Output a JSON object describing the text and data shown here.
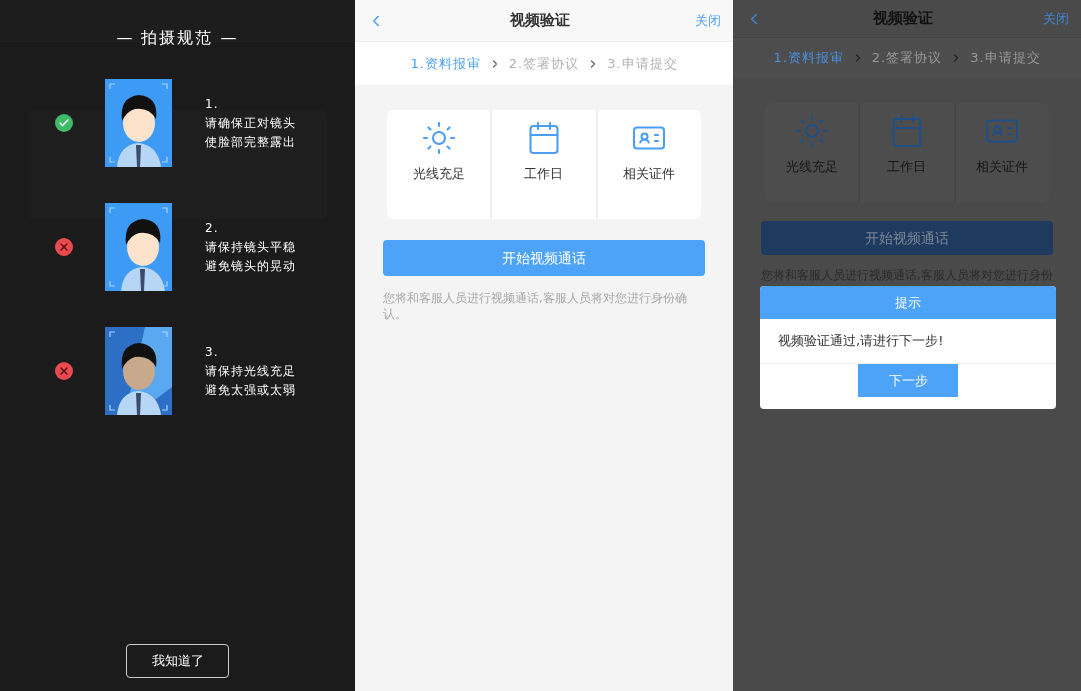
{
  "left_screen": {
    "guide": {
      "title": "— 拍摄规范 —",
      "rules": [
        {
          "number": "1.",
          "lines": [
            "请确保正对镜头",
            "使脸部完整露出"
          ],
          "correct": true
        },
        {
          "number": "2.",
          "lines": [
            "请保持镜头平稳",
            "避免镜头的晃动"
          ],
          "correct": false
        },
        {
          "number": "3.",
          "lines": [
            "请保持光线充足",
            "避免太强或太弱"
          ],
          "correct": false
        }
      ],
      "confirm_button": "我知道了"
    }
  },
  "center_screen": {
    "screen": {
      "title": "视频验证",
      "close_label": "关闭",
      "steps": [
        {
          "label": "1.资料报审",
          "selected": true
        },
        {
          "label": "2.签署协议",
          "selected": false
        },
        {
          "label": "3.申请提交",
          "selected": false
        }
      ],
      "requirements": [
        {
          "label": "光线充足",
          "kind": "sun"
        },
        {
          "label": "工作日",
          "kind": "calendar"
        },
        {
          "label": "相关证件",
          "kind": "id-card"
        }
      ],
      "start_button": "开始视频通话",
      "note": "您将和客服人员进行视频通话,客服人员将对您进行身份确认。"
    }
  },
  "right_screen": {
    "screen": {
      "title": "视频验证",
      "close_label": "关闭",
      "steps": [
        {
          "label": "1.资料报审",
          "selected": true
        },
        {
          "label": "2.签署协议",
          "selected": false
        },
        {
          "label": "3.申请提交",
          "selected": false
        }
      ],
      "requirements": [
        {
          "label": "光线充足",
          "kind": "sun"
        },
        {
          "label": "工作日",
          "kind": "calendar"
        },
        {
          "label": "相关证件",
          "kind": "id-card"
        }
      ],
      "start_button": "开始视频通话",
      "note": "您将和客服人员进行视频通话,客服人员将对您进行身份"
    },
    "dialog": {
      "title": "提示",
      "message": "视频验证通过,请进行下一步!",
      "button": "下一步"
    }
  }
}
